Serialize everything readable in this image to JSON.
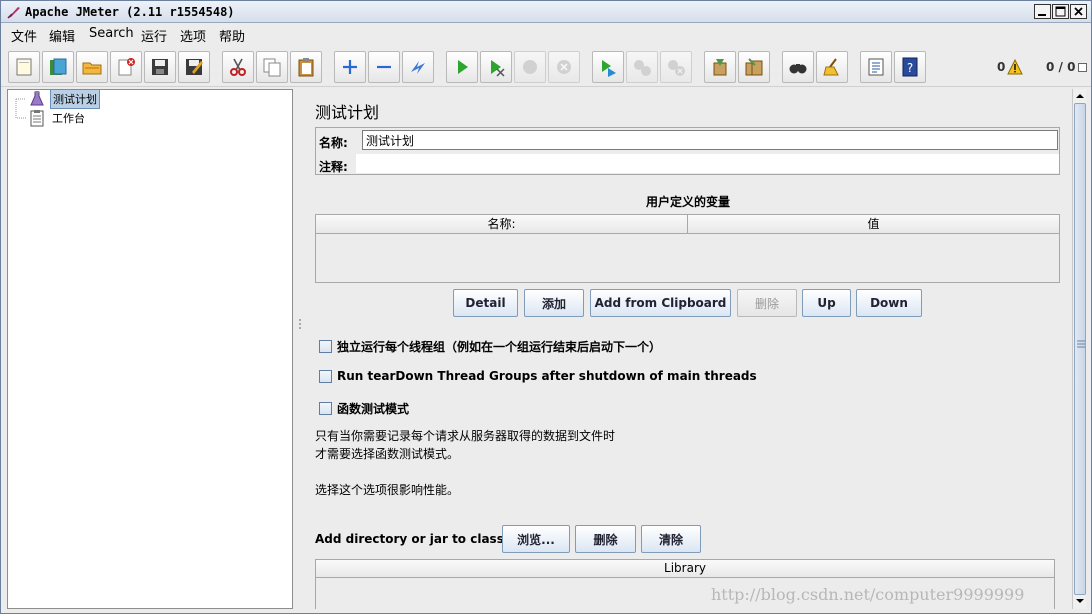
{
  "window": {
    "title": "Apache JMeter (2.11 r1554548)"
  },
  "menu": [
    "文件",
    "编辑",
    "Search",
    "运行",
    "选项",
    "帮助"
  ],
  "toolbar": {
    "buttons": [
      {
        "icon": "new-file-icon"
      },
      {
        "icon": "templates-icon"
      },
      {
        "icon": "open-folder-icon"
      },
      {
        "icon": "close-file-icon"
      },
      {
        "icon": "save-icon"
      },
      {
        "icon": "save-as-icon"
      },
      {
        "icon": "cut-icon"
      },
      {
        "icon": "copy-icon"
      },
      {
        "icon": "paste-icon"
      },
      {
        "icon": "expand-icon"
      },
      {
        "icon": "collapse-icon"
      },
      {
        "icon": "toggle-icon"
      },
      {
        "icon": "start-icon"
      },
      {
        "icon": "start-no-timers-icon"
      },
      {
        "icon": "stop-icon"
      },
      {
        "icon": "shutdown-icon"
      },
      {
        "icon": "remote-start-icon"
      },
      {
        "icon": "remote-stop-icon"
      },
      {
        "icon": "remote-shutdown-icon"
      },
      {
        "icon": "clear-icon"
      },
      {
        "icon": "clear-all-icon"
      },
      {
        "icon": "search-icon"
      },
      {
        "icon": "reset-search-icon"
      },
      {
        "icon": "function-helper-icon"
      },
      {
        "icon": "help-icon"
      }
    ],
    "warning_count": "0",
    "thread_count": "0 / 0"
  },
  "tree": {
    "nodes": [
      {
        "label": "测试计划",
        "selected": true
      },
      {
        "label": "工作台",
        "selected": false
      }
    ]
  },
  "panel": {
    "title": "测试计划",
    "name_label": "名称:",
    "name_value": "测试计划",
    "comment_label": "注释:",
    "comment_value": "",
    "vars_title": "用户定义的变量",
    "vars_columns": [
      "名称:",
      "值"
    ],
    "buttons": {
      "detail": "Detail",
      "add": "添加",
      "add_clipboard": "Add from Clipboard",
      "delete": "删除",
      "up": "Up",
      "down": "Down"
    },
    "checks": [
      {
        "label": "独立运行每个线程组（例如在一个组运行结束后启动下一个）",
        "checked": false
      },
      {
        "label": "Run tearDown Thread Groups after shutdown of main threads",
        "checked": false
      },
      {
        "label": "函数测试模式",
        "checked": false
      }
    ],
    "info_lines": [
      "只有当你需要记录每个请求从服务器取得的数据到文件时",
      "才需要选择函数测试模式。",
      "选择这个选项很影响性能。"
    ],
    "classpath_label": "Add directory or jar to classpath",
    "classpath_buttons": {
      "browse": "浏览...",
      "delete": "删除",
      "clear": "清除"
    },
    "library_column": "Library"
  },
  "watermark": "http://blog.csdn.net/computer9999999"
}
